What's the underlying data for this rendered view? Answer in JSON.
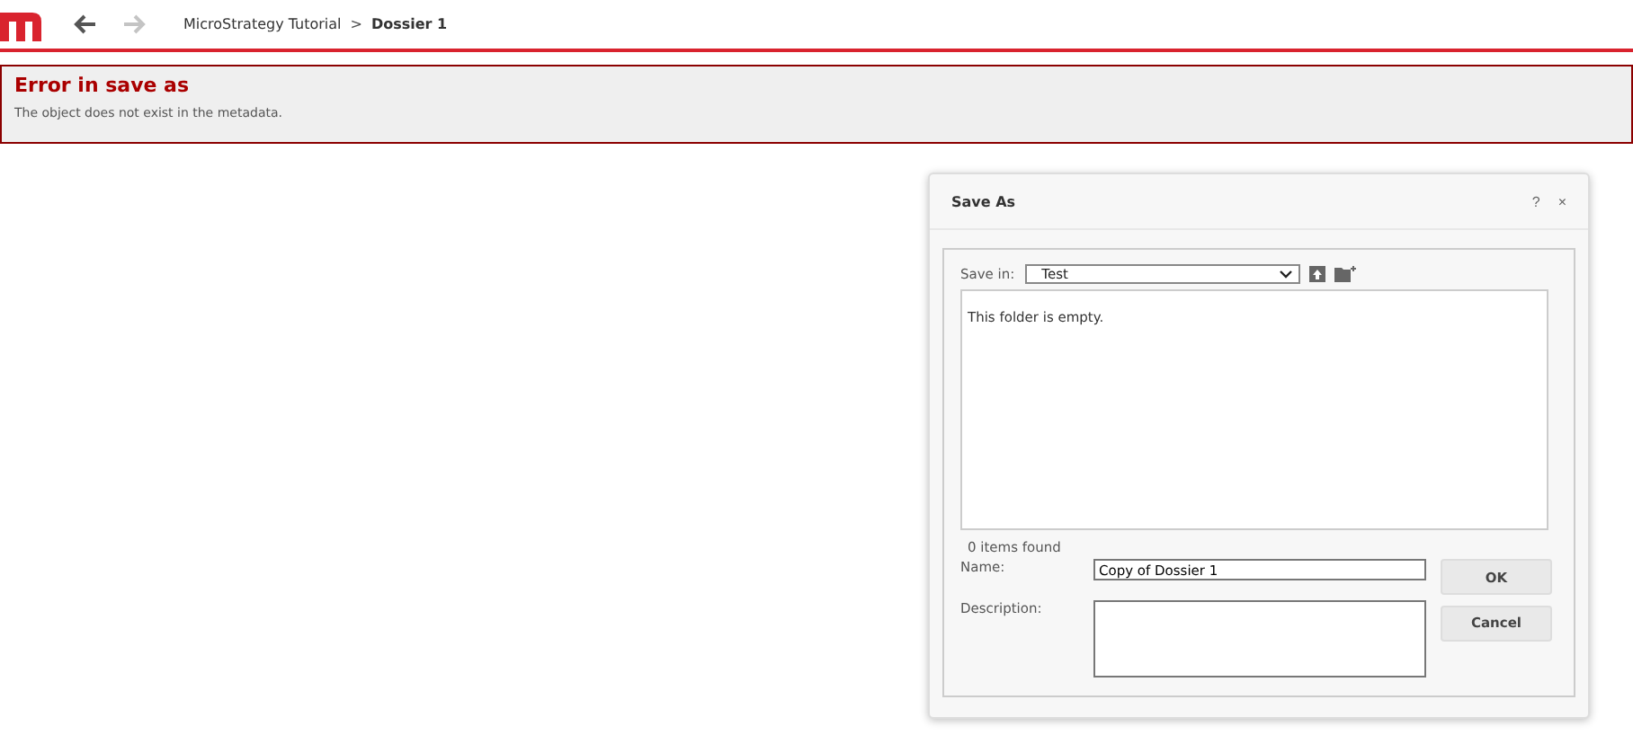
{
  "toolbar": {
    "back": {
      "disabled": false
    },
    "forward": {
      "disabled": true
    },
    "breadcrumb": [
      {
        "label": "MicroStrategy Tutorial",
        "current": false
      },
      {
        "label": "Dossier 1",
        "current": true
      }
    ],
    "separator": ">"
  },
  "error": {
    "title": "Error in save as",
    "message": "The object does not exist in the metadata."
  },
  "dialog": {
    "title": "Save As",
    "help": "?",
    "close": "×",
    "save_in_label": "Save in:",
    "save_in_value": "Test",
    "empty_message": "This folder is empty.",
    "count": "0 items found",
    "name_label": "Name:",
    "name_value": "Copy of Dossier 1",
    "description_label": "Description:",
    "buttons": [
      "OK",
      "Cancel"
    ]
  }
}
